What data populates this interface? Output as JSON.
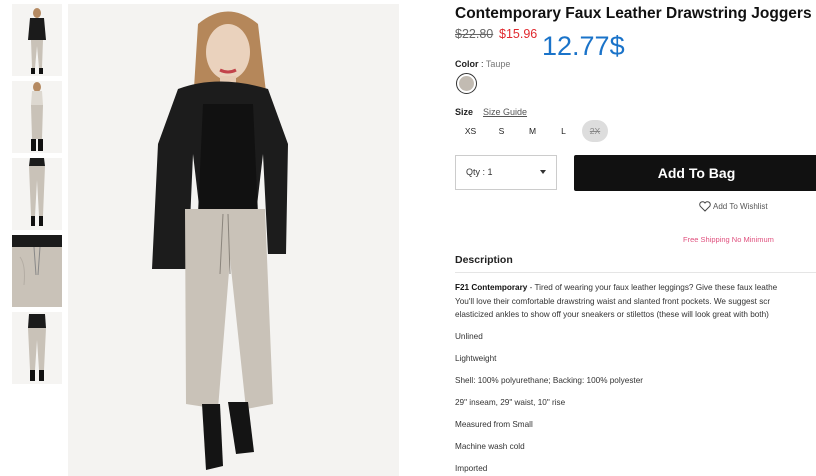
{
  "product": {
    "title": "Contemporary Faux Leather Drawstring Joggers",
    "price_original": "$22.80",
    "price_sale": "$15.96",
    "price_overlay": "12.77$",
    "color_label": "Color",
    "color_separator": ":",
    "color_value": "Taupe",
    "color_swatch": "#c2bbb2",
    "size_label": "Size",
    "size_guide": "Size Guide",
    "sizes": [
      "XS",
      "S",
      "M",
      "L",
      "2X"
    ],
    "qty_label": "Qty : 1",
    "add_to_bag": "Add To Bag",
    "wishlist": "Add To Wishlist",
    "shipping": "Free Shipping No Minimum"
  },
  "description": {
    "heading": "Description",
    "brand": "F21 Contemporary",
    "text_line1": " - Tired of wearing your faux leather leggings? Give these faux leathe",
    "text_line2": "You'll love their comfortable drawstring waist and slanted front pockets. We suggest scr",
    "text_line3": "elasticized ankles to show off your sneakers or stilettos (these will look great with both)",
    "specs": [
      "Unlined",
      "Lightweight",
      "Shell: 100% polyurethane; Backing: 100% polyester",
      "29\" inseam, 29\" waist, 10\" rise",
      "Measured from Small",
      "Machine wash cold",
      "Imported"
    ]
  },
  "colors": {
    "sale": "#e0282e",
    "overlay": "#1a73c9",
    "shipping": "#e0507e",
    "button": "#111111"
  }
}
